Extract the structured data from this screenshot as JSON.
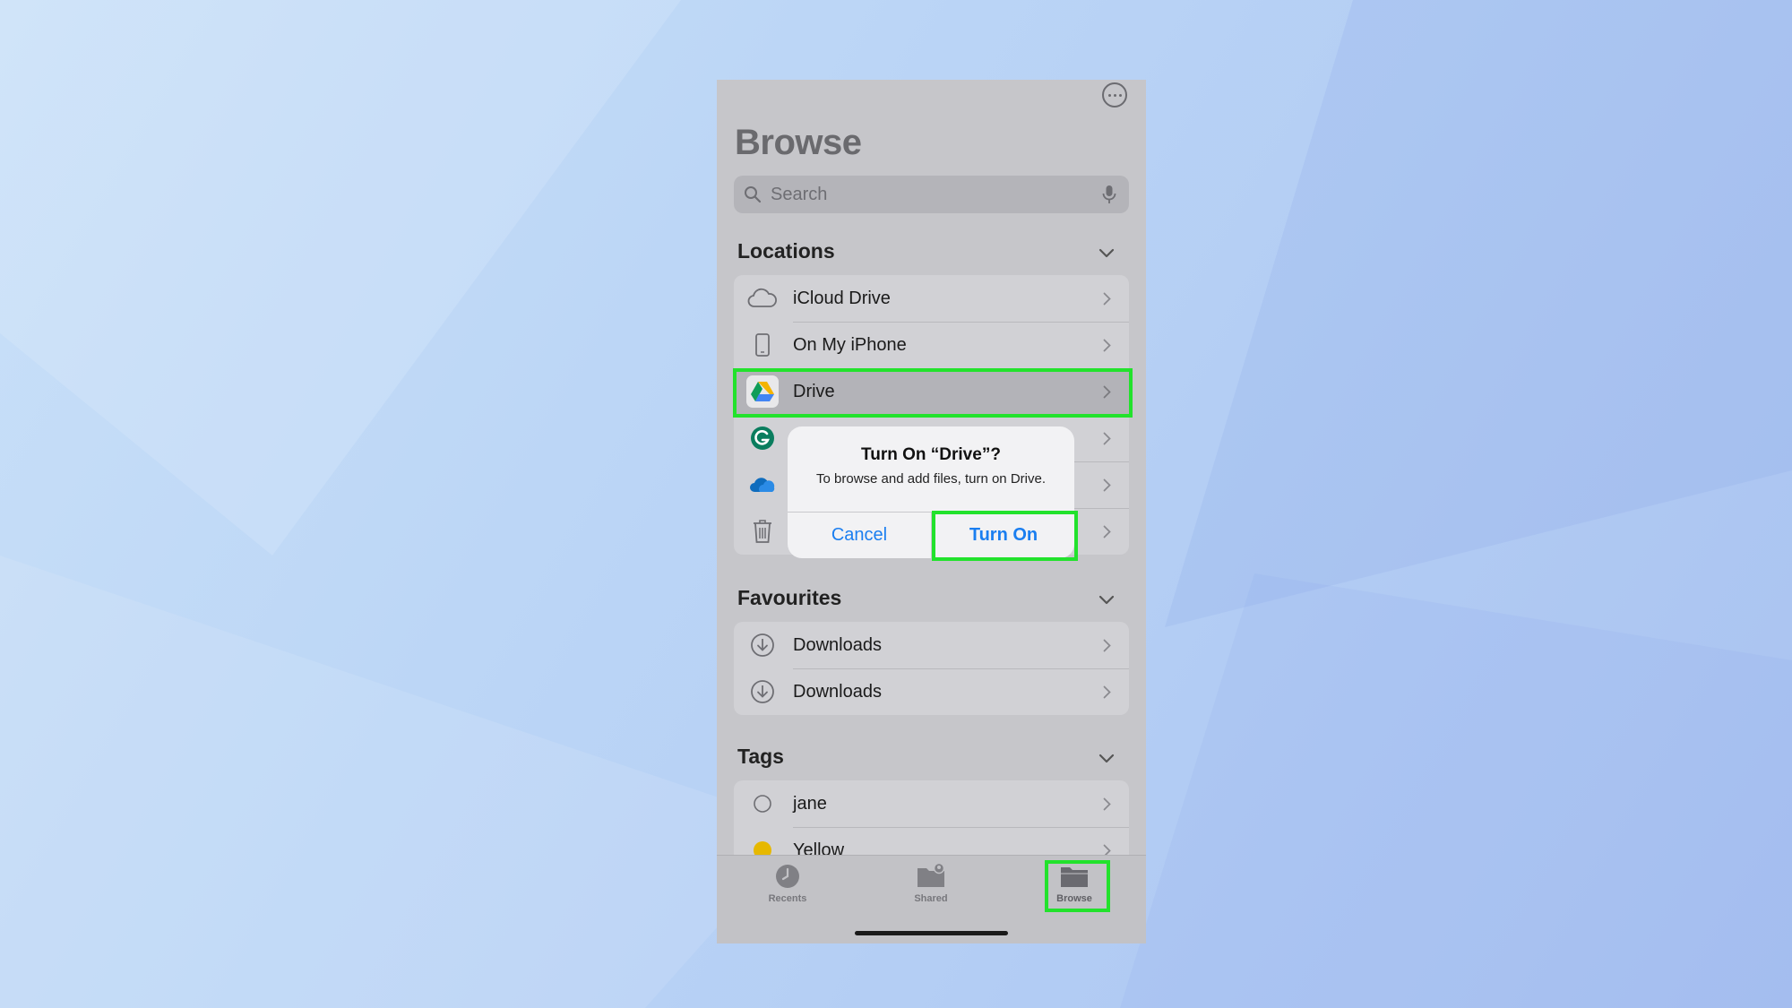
{
  "header": {
    "title": "Browse"
  },
  "search": {
    "placeholder": "Search"
  },
  "locations": {
    "header": "Locations",
    "items": [
      {
        "label": "iCloud Drive",
        "icon": "cloud-icon"
      },
      {
        "label": "On My iPhone",
        "icon": "iphone-icon"
      },
      {
        "label": "Drive",
        "icon": "google-drive-icon"
      },
      {
        "label": "",
        "icon": "grammarly-icon"
      },
      {
        "label": "",
        "icon": "onedrive-icon"
      },
      {
        "label": "",
        "icon": "trash-icon"
      }
    ]
  },
  "favourites": {
    "header": "Favourites",
    "items": [
      {
        "label": "Downloads",
        "icon": "download-icon"
      },
      {
        "label": "Downloads",
        "icon": "download-icon"
      }
    ]
  },
  "tags": {
    "header": "Tags",
    "items": [
      {
        "label": "jane",
        "icon": "tag-circle-empty-icon"
      },
      {
        "label": "Yellow",
        "icon": "tag-circle-yellow-icon",
        "color": "#e6b800"
      }
    ]
  },
  "alert": {
    "title": "Turn On “Drive”?",
    "message": "To browse and add files, turn on Drive.",
    "cancel": "Cancel",
    "confirm": "Turn On"
  },
  "tabbar": {
    "items": [
      {
        "label": "Recents",
        "icon": "clock-icon"
      },
      {
        "label": "Shared",
        "icon": "shared-folder-icon"
      },
      {
        "label": "Browse",
        "icon": "folder-icon",
        "selected": true
      }
    ]
  },
  "colors": {
    "highlight": "#22e22c",
    "accent": "#1a7ef0"
  }
}
